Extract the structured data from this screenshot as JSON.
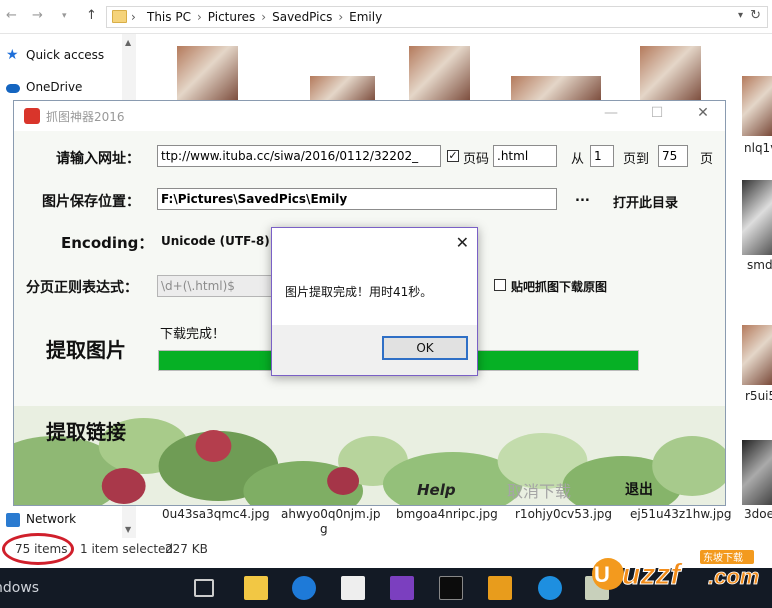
{
  "explorer": {
    "breadcrumb": [
      "This PC",
      "Pictures",
      "SavedPics",
      "Emily"
    ],
    "nav_items": {
      "quick_access": "Quick access",
      "onedrive": "OneDrive",
      "network": "Network"
    },
    "files": [
      {
        "name": "0u43sa3qmc4.jpg"
      },
      {
        "name": "ahwyo0q0njm.jp",
        "name2": "g"
      },
      {
        "name": "bmgoa4nripc.jpg"
      },
      {
        "name": "r1ohjy0cv53.jpg"
      },
      {
        "name": "ej51u43z1hw.jpg"
      },
      {
        "name": "3doe"
      }
    ],
    "side_files": {
      "a": "nlq1v",
      "b": "smd",
      "c": "r5ui5"
    },
    "status": {
      "count": "75 items",
      "selection": "1 item selected",
      "size": "227 KB"
    },
    "taskbar_text": "ndows"
  },
  "app": {
    "title": "抓图神器2016",
    "url_label": "请输入网址：",
    "url_value": "ttp://www.ituba.cc/siwa/2016/0112/32202_",
    "page_code_label": "页码",
    "page_suffix_value": ".html",
    "from_label": "从",
    "from_value": "1",
    "to_label": "页到",
    "to_value": "75",
    "page_unit": "页",
    "save_label": "图片保存位置：",
    "save_value": "F:\\Pictures\\SavedPics\\Emily",
    "browse_label": "...",
    "open_dir_label": "打开此目录",
    "encoding_label": "Encoding：",
    "encoding_value": "Unicode (UTF-8)",
    "regex_label": "分页正则表达式：",
    "regex_value": "\\d+(\\.html)$",
    "tieba_label": "贴吧抓图下载原图",
    "download_status": "下载完成！",
    "progress": 1.0,
    "extract_images": "提取图片",
    "extract_links": "提取链接",
    "help": "Help",
    "cancel_download": "取消下载",
    "exit": "退出"
  },
  "dialog": {
    "message": "图片提取完成！用时41秒。",
    "ok": "OK",
    "close": "✕"
  },
  "watermark": {
    "text": "uzzf",
    "suffix": ".com",
    "sub": "东坡下载"
  }
}
